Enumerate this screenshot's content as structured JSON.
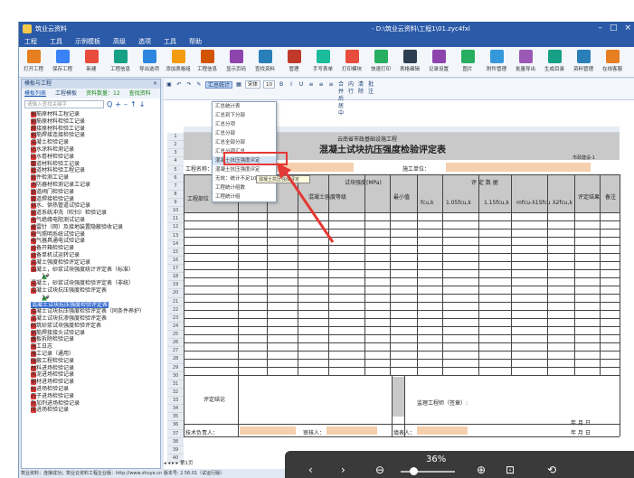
{
  "window": {
    "title": "筑业云资料",
    "document": "- D:\\筑业云资料\\工程1\\01.zyc4fxl"
  },
  "menu": [
    "工程",
    "工具",
    "示例模板",
    "高级",
    "选项",
    "工具",
    "帮助"
  ],
  "ribbon": [
    "打开工程",
    "保存工程",
    "新建",
    "工程信息",
    "导出选项",
    "添加表格组",
    "工程信息",
    "显示页码",
    "查找资料",
    "管理",
    "手写表单",
    "打印模块",
    "快速打印",
    "表格编辑",
    "记录设置",
    "图片",
    "附件管理",
    "批量导出",
    "生成目录",
    "资料管理",
    "在线客服"
  ],
  "left_panel": {
    "title": "模板与工程",
    "tabs": [
      "模板列表",
      "工程模板",
      "资料数量：12",
      "查找资料"
    ],
    "search_placeholder": "请输入查找关键字",
    "tree": [
      "钢筋原材料工程记录",
      "钢筋原材料检验工记录",
      "焊接原材料检验工记录",
      "钢筋焊接连接检验记录",
      "混凝土检验记录",
      "防水涂料检测记录",
      "防水卷材检验记录",
      "管道材料检验工记录",
      "管道材料检验工程记录",
      "管件检测工记录",
      "消防器材检测记录工记录",
      "管道阀门检验记录",
      "管道焊接检验记录",
      "供水、供热管道试验记录",
      "管道系统冲洗（吹扫）检验记录",
      "电气绝缘电阻测试记录",
      "避雷针（网）及接地装置隐蔽验收记录",
      "电气照明系统试验记录",
      "电气器具通电试验记录",
      "设备开箱检验记录",
      "设备单机试运转记录",
      "混凝土强度检验评定记录",
      "混凝土，砂浆试块强度统计评定表（标准）",
      "1#",
      "混凝土，砂浆试块强度检验评定表（非统）",
      "混凝土试块抗压强度检验评定表",
      "1#",
      "混凝土试块抗压强度检验评定表",
      "混凝土试块抗压强度检验评定表（同条件养护）",
      "混凝土试块抗渗强度检验评定表",
      "砌筑砂浆试块强度检验评定表",
      "钢筋焊接接头试验记录",
      "模板拆除检验记录",
      "施工日志",
      "施工记录（通用）",
      "隐蔽工程检验记录",
      "材料进场检验记录",
      "水泥进场检验记录",
      "钢材进场检验记录",
      "砂进场检验记录",
      "石子进场检验记录",
      "外加剂进场检验记录",
      "砖进场检验记录"
    ],
    "selected_index": 27
  },
  "format_toolbar": {
    "font": "宋体",
    "size": "10",
    "highlight_btn": "汇总统计",
    "items": [
      "保存",
      "文字",
      "表格格式",
      "工具",
      "合并后居中",
      "内行",
      "清除",
      "批注"
    ]
  },
  "popup": {
    "items": [
      "汇总统计表",
      "汇总到下分部",
      "汇总分项",
      "汇总分部",
      "汇总全部分部",
      "汇总分项汇总",
      "混凝土抗压强度评定",
      "混凝土抗压强度评定",
      "无效：统计不足10组",
      "工程统计组数",
      "工程统计组"
    ],
    "highlighted": 6,
    "tooltip": "混凝土抗压强度评定"
  },
  "sheet": {
    "project_line": "云南省市政基础设施工程",
    "title": "混凝土试块抗压强度检验评定表",
    "code": "市政建设-1",
    "labels": {
      "unit_project": "工程名称：",
      "design_grade": "设计强度等级",
      "construction_unit": "施工单位：",
      "structure_part": "工程部位",
      "concrete_strength": "混凝土强度等级",
      "group_count": "组数",
      "age": "龄期",
      "strength": "试块强度(MPa)",
      "min_value": "最小值",
      "eval": "评 定 数 据",
      "fcu_k": "fcu,k",
      "lambda1": "1.05fcu,k",
      "lambda2": "1.15fcu,k",
      "mfcu": "mfcu-λ1Sfcu",
      "lambda_min": "λ2fcu,k",
      "result": "评定结果",
      "note": "备注",
      "eval_conclusion": "评定结论",
      "supervise": "监理工程师（签章）:",
      "date": "年 月 日",
      "tech_leader": "技术负责人：",
      "reviewer": "审核人：",
      "recorder": "填表人："
    }
  },
  "sheet_tabs": "第1页",
  "status": "筑业资料：连接成功；筑业云资料工程企业版：http://www.zhuye.cn  版本号: 2.56.01（试运行版）",
  "viewer": {
    "zoom": "36%"
  }
}
